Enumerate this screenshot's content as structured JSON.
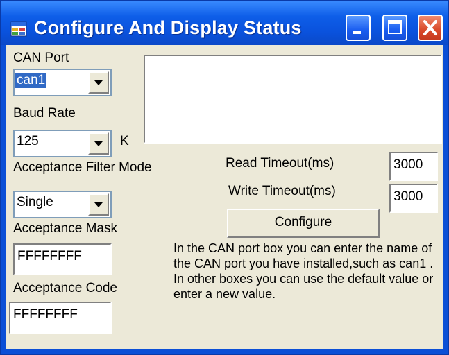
{
  "window": {
    "title": "Configure And Display Status",
    "controls": [
      "minimize",
      "maximize",
      "close"
    ]
  },
  "can_port": {
    "label": "CAN Port",
    "value": "can1"
  },
  "baud_rate": {
    "label": "Baud Rate",
    "value": "125",
    "unit": "K"
  },
  "filter_mode": {
    "label": "Acceptance Filter Mode",
    "value": "Single"
  },
  "mask": {
    "label": "Acceptance Mask",
    "value": "FFFFFFFF"
  },
  "code": {
    "label": "Acceptance Code",
    "value": "FFFFFFFF"
  },
  "read_timeout": {
    "label": "Read Timeout(ms)",
    "value": "3000"
  },
  "write_timeout": {
    "label": "Write Timeout(ms)",
    "value": "3000"
  },
  "configure_button": {
    "label": "Configure"
  },
  "help_text": "In the CAN port box you can enter the name of the CAN port you have installed,such as can1 . In other boxes you can use the default value or enter a new value.",
  "icons": {
    "app": "app-window-icon",
    "minimize": "minimize-icon",
    "maximize": "maximize-icon",
    "close": "close-icon",
    "dropdown": "chevron-down-icon"
  },
  "colors": {
    "titlebar": "#0a52dd",
    "client": "#ece9d8",
    "close_button": "#d9492a",
    "selection": "#316ac5"
  }
}
